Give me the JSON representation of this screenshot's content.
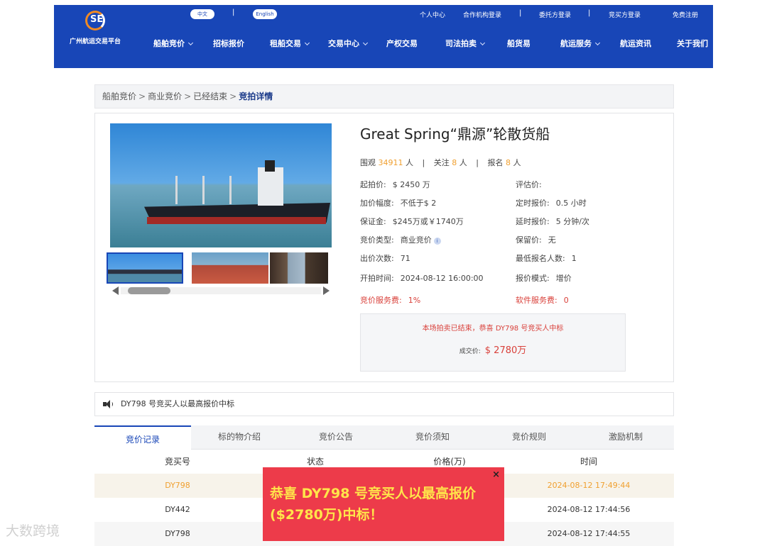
{
  "header": {
    "logo_text": "广州航运交易平台",
    "logo_mark": "SE",
    "lang_active": "中文",
    "lang_other": "English",
    "top_links": [
      "个人中心",
      "合作机构登录",
      "委托方登录",
      "竞买方登录",
      "免费注册"
    ],
    "nav": [
      {
        "label": "船舶竞价",
        "dropdown": true
      },
      {
        "label": "招标报价",
        "dropdown": false
      },
      {
        "label": "租船交易",
        "dropdown": true
      },
      {
        "label": "交易中心",
        "dropdown": true
      },
      {
        "label": "产权交易",
        "dropdown": false
      },
      {
        "label": "司法拍卖",
        "dropdown": true
      },
      {
        "label": "船货易",
        "dropdown": false
      },
      {
        "label": "航运服务",
        "dropdown": true
      },
      {
        "label": "航运资讯",
        "dropdown": false
      },
      {
        "label": "关于我们",
        "dropdown": true
      }
    ]
  },
  "breadcrumb": [
    "船舶竞价",
    "商业竞价",
    "已经结束",
    "竞拍详情"
  ],
  "listing": {
    "title": "Great Spring“鼎源”轮散货船",
    "views_label": "围观",
    "views": "34911",
    "follow_label": "关注",
    "follow": "8",
    "signup_label": "报名",
    "signup": "8",
    "unit_person": "人",
    "fields_left": [
      {
        "label": "起拍价:",
        "value": "$ 2450 万"
      },
      {
        "label": "加价幅度:",
        "value": "不低于$ 2"
      },
      {
        "label": "保证金:",
        "value": "$245万或￥1740万"
      },
      {
        "label": "竞价类型:",
        "value": "商业竞价"
      },
      {
        "label": "出价次数:",
        "value": "71"
      },
      {
        "label": "开拍时间:",
        "value": "2024-08-12 16:00:00"
      }
    ],
    "fields_right": [
      {
        "label": "评估价:",
        "value": ""
      },
      {
        "label": "定时报价:",
        "value": "0.5 小时"
      },
      {
        "label": "延时报价:",
        "value": "5 分钟/次"
      },
      {
        "label": "保留价:",
        "value": "无"
      },
      {
        "label": "最低报名人数:",
        "value": "1"
      },
      {
        "label": "报价模式:",
        "value": "增价"
      }
    ],
    "service_fee_label": "竞价服务费:",
    "service_fee": "1%",
    "software_fee_label": "软件服务费:",
    "software_fee": "0",
    "info_icon": "i",
    "result_message": "本场拍卖已结束，恭喜 DY798 号竞买人中标",
    "deal_label": "成交价:",
    "deal_price": "$ 2780万"
  },
  "notice": "DY798 号竞买人以最高报价中标",
  "tabs": [
    "竞价记录",
    "标的物介绍",
    "竞价公告",
    "竞价须知",
    "竞价规则",
    "激励机制"
  ],
  "table": {
    "headers": [
      "竞买号",
      "状态",
      "价格(万)",
      "时间"
    ],
    "rows": [
      {
        "bidder": "DY798",
        "time": "2024-08-12 17:49:44"
      },
      {
        "bidder": "DY442",
        "time": "2024-08-12 17:44:56"
      },
      {
        "bidder": "DY798",
        "time": "2024-08-12 17:44:55"
      }
    ]
  },
  "popup": {
    "text": "恭喜 DY798 号竞买人以最高报价($2780万)中标！",
    "close": "×"
  },
  "watermark": "大数跨境"
}
